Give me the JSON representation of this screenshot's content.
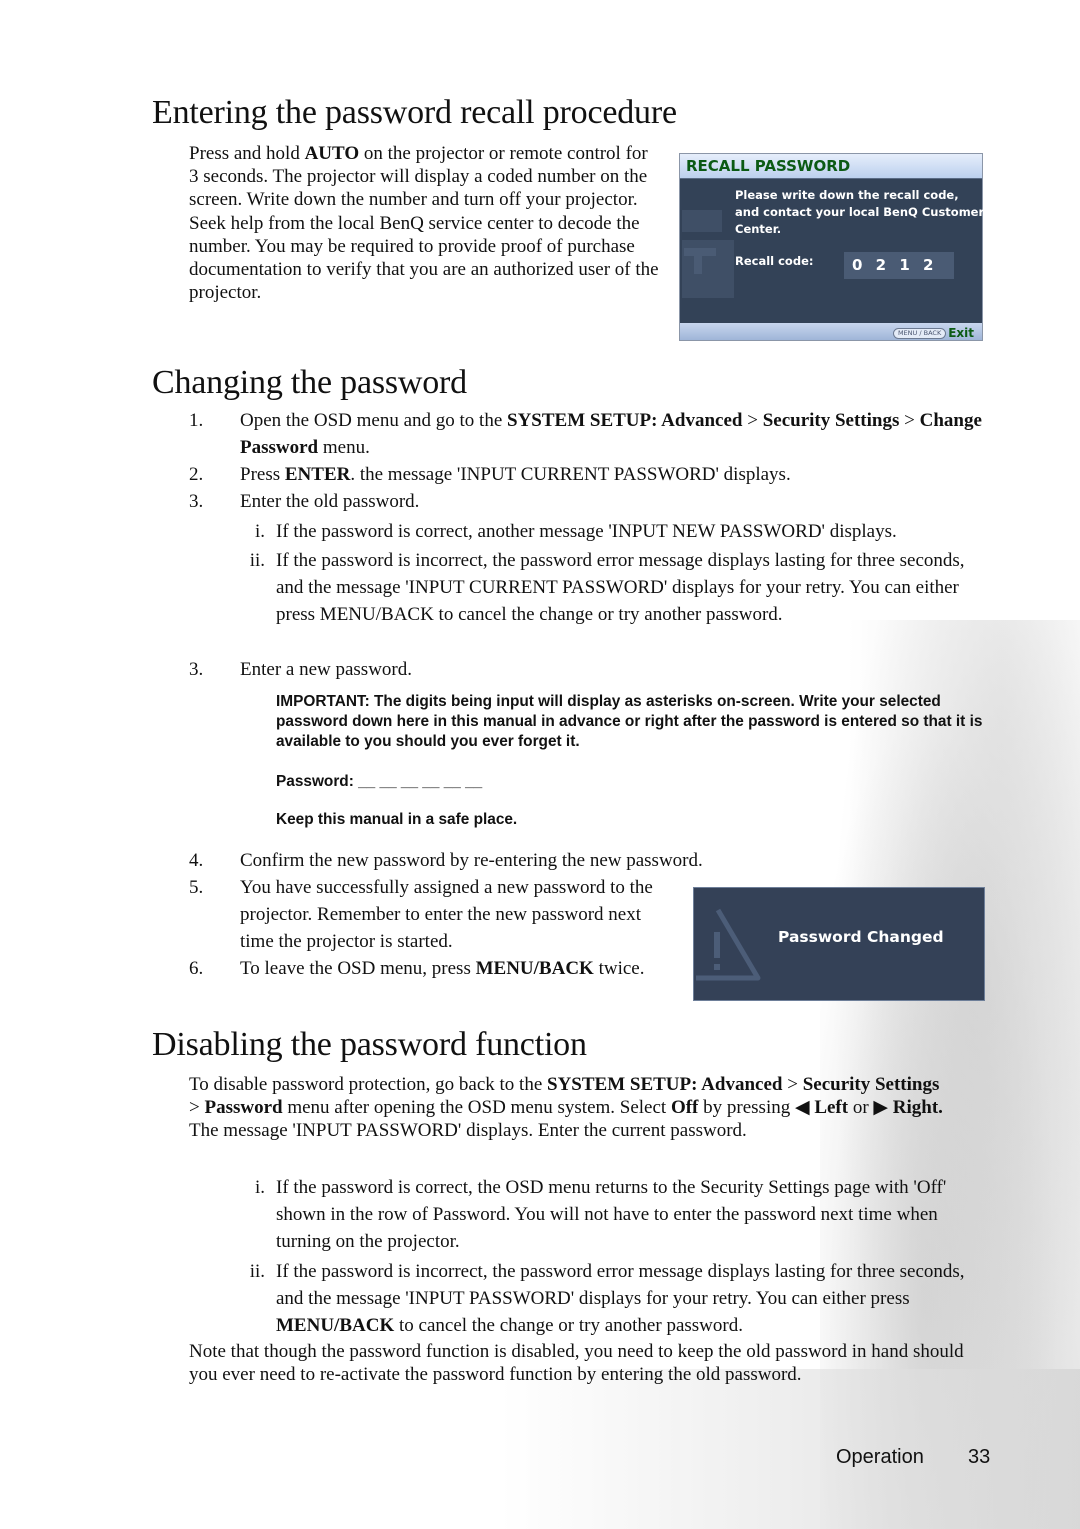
{
  "sections": {
    "recall": {
      "title": "Entering the password recall procedure",
      "body_parts": [
        {
          "t": "Press and hold ",
          "b": false
        },
        {
          "t": "AUTO",
          "b": true
        },
        {
          "t": " on the projector or remote control for 3 seconds. The projector will display a coded number on the screen. Write down the number and turn off your projector. Seek help from the local BenQ service center to decode the number. You may be required to provide proof of purchase documentation to verify that you are an authorized user of the projector.",
          "b": false
        }
      ]
    },
    "changing": {
      "title": "Changing the password",
      "steps": [
        {
          "num": "1.",
          "parts": [
            {
              "t": "Open the OSD menu and go to the ",
              "b": false
            },
            {
              "t": "SYSTEM SETUP: Advanced",
              "b": true
            },
            {
              "t": " > ",
              "b": false
            },
            {
              "t": "Security Settings",
              "b": true
            },
            {
              "t": " > ",
              "b": false
            },
            {
              "t": "Change Password",
              "b": true
            },
            {
              "t": " menu.",
              "b": false
            }
          ]
        },
        {
          "num": "2.",
          "parts": [
            {
              "t": "Press ",
              "b": false
            },
            {
              "t": "ENTER",
              "b": true
            },
            {
              "t": ". the message 'INPUT CURRENT PASSWORD' displays.",
              "b": false
            }
          ]
        },
        {
          "num": "3.",
          "parts": [
            {
              "t": "Enter the old password.",
              "b": false
            }
          ]
        }
      ],
      "substeps": [
        {
          "num": "i.",
          "text": "If the password is correct, another message 'INPUT NEW PASSWORD' displays."
        },
        {
          "num": "ii.",
          "text": "If the password is incorrect, the password error message displays lasting for three seconds, and the message 'INPUT CURRENT PASSWORD' displays for your retry. You can either press MENU/BACK to cancel the change or try another password."
        }
      ],
      "step3b": {
        "num": "3.",
        "text": "Enter a new password."
      },
      "important": "IMPORTANT: The digits being input will display as asterisks on-screen. Write your selected password down here in this manual in advance or right after the password is entered so that it is available to you should you ever forget it.",
      "password_label": "Password: __ __ __ __ __ __",
      "keep_safe": "Keep this manual in a safe place.",
      "later_steps": [
        {
          "num": "4.",
          "parts": [
            {
              "t": "Confirm the new password by re-entering the new password.",
              "b": false
            }
          ]
        },
        {
          "num": "5.",
          "parts": [
            {
              "t": "You have successfully assigned a new password to the projector. Remember to enter the new password next time the projector is started.",
              "b": false
            }
          ]
        },
        {
          "num": "6.",
          "parts": [
            {
              "t": "To leave the OSD menu, press ",
              "b": false
            },
            {
              "t": "MENU/BACK",
              "b": true
            },
            {
              "t": " twice.",
              "b": false
            }
          ]
        }
      ]
    },
    "disabling": {
      "title": "Disabling the password function",
      "intro_parts": [
        {
          "t": "To disable password protection, go back to the ",
          "b": false
        },
        {
          "t": "SYSTEM SETUP: Advanced",
          "b": true
        },
        {
          "t": " > ",
          "b": false
        },
        {
          "t": "Security Settings",
          "b": true
        },
        {
          "t": " > ",
          "b": false
        },
        {
          "t": "Password",
          "b": true
        },
        {
          "t": " menu after opening the OSD menu system. Select ",
          "b": false
        },
        {
          "t": "Off",
          "b": true
        },
        {
          "t": " by pressing ",
          "b": false
        },
        {
          "t": "◀ Left",
          "b": true
        },
        {
          "t": " or ",
          "b": false
        },
        {
          "t": "▶ Right.",
          "b": true
        },
        {
          "t": " The message 'INPUT PASSWORD' displays. Enter the current password.",
          "b": false
        }
      ],
      "substeps": [
        {
          "num": "i.",
          "parts": [
            {
              "t": "If the password is correct, the OSD menu returns to the Security Settings page with 'Off' shown in the row of Password. You will not have to enter the password next time when turning on the projector.",
              "b": false
            }
          ]
        },
        {
          "num": "ii.",
          "parts": [
            {
              "t": "If the password is incorrect, the password error message displays lasting for three seconds, and the message 'INPUT PASSWORD' displays for your retry. You can either press ",
              "b": false
            },
            {
              "t": "MENU/BACK",
              "b": true
            },
            {
              "t": " to cancel the change or try another password.",
              "b": false
            }
          ]
        }
      ],
      "note": "Note that though the password function is disabled, you need to keep the old password in hand should you ever need to re-activate the password function by entering the old password."
    }
  },
  "osd_recall": {
    "title": "RECALL PASSWORD",
    "message": "Please write down the recall code, and contact your local BenQ Customer Center.",
    "code_label": "Recall code:",
    "code": "0 2 1 2",
    "menu_button": "MENU / BACK",
    "exit_label": "Exit",
    "icon": "lock-icon",
    "colors": {
      "title": "#0b5a14",
      "body": "#334257",
      "header": "#bcd0ee"
    }
  },
  "osd_changed": {
    "label": "Password Changed",
    "icon": "warning-icon",
    "colors": {
      "body": "#344157"
    }
  },
  "footer": {
    "section": "Operation",
    "page": "33"
  }
}
